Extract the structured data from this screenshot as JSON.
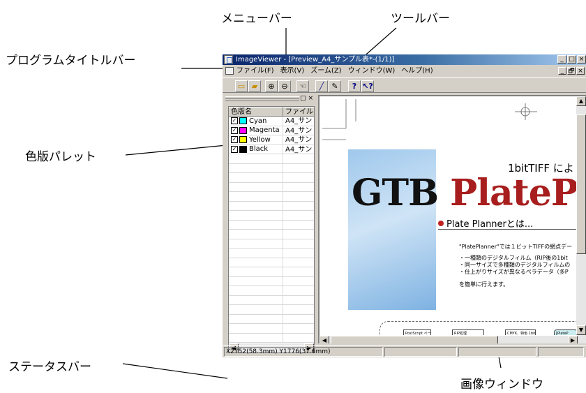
{
  "callouts": {
    "menubar": "メニューバー",
    "toolbar": "ツールバー",
    "titlebar": "プログラムタイトルバー",
    "palette": "色版パレット",
    "statusbar": "ステータスバー",
    "imagewindow": "画像ウィンドウ"
  },
  "window": {
    "title": "ImageViewer - [Preview_A4_サンプル表*-(1/1)]",
    "caption_buttons": [
      "_",
      "□",
      "×"
    ],
    "mdi_buttons": [
      "_",
      "🗗",
      "×"
    ]
  },
  "menu": [
    "ファイル(F)",
    "表示(V)",
    "ズーム(Z)",
    "ウィンドウ(W)",
    "ヘルプ(H)"
  ],
  "toolbar_icons": [
    "open-icon",
    "open-folder-icon",
    "zoom-in-icon",
    "zoom-out-icon",
    "hand-icon",
    "eyedropper-icon",
    "pen-icon",
    "help-icon",
    "context-help-icon"
  ],
  "palette": {
    "columns": [
      "色版名",
      "ファイル"
    ],
    "plates": [
      {
        "name": "Cyan",
        "file": "A4_サン",
        "color": "#00ffff",
        "checked": true
      },
      {
        "name": "Magenta",
        "file": "A4_サン",
        "color": "#ff00ff",
        "checked": true
      },
      {
        "name": "Yellow",
        "file": "A4_サン",
        "color": "#ffff00",
        "checked": true
      },
      {
        "name": "Black",
        "file": "A4_サン",
        "color": "#000000",
        "checked": true
      }
    ]
  },
  "preview": {
    "subtitle": "1bitTIFF によ",
    "headline_a": "GTB",
    "headline_b": "PlateP",
    "section_title": "Plate Plannerとは...",
    "body": [
      "\"PlatePlanner\"では１ビットTIFFの網点デー",
      "・一種類のデジタルフィルム（RIP後の1bit",
      "・同一サイズで多種類のデジタルフィルムの",
      "・仕上がりサイズが異なるペラデータ（多P",
      "を簡単に行えます。"
    ],
    "flow": [
      "PostScript ページデータ",
      "RIP処理",
      "CMYK、特色 1bit 網点データ",
      "[PlateP"
    ]
  },
  "status": {
    "coordinates": "X2752(58.3mm) Y1776(37.6mm)"
  }
}
